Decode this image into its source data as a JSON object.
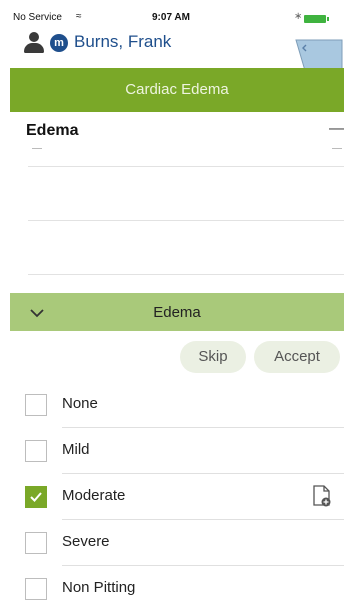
{
  "status_bar": {
    "carrier": "No Service",
    "wifi_icon": "wifi-icon",
    "time": "9:07 AM",
    "bluetooth_icon": "bluetooth-icon",
    "battery_icon": "battery-icon",
    "battery_color": "#3fb33f"
  },
  "patient": {
    "person_icon": "person-icon",
    "badge_letter": "m",
    "name": "Burns, Frank"
  },
  "title_bar": {
    "title": "Cardiac Edema",
    "color": "#7aa828"
  },
  "section": {
    "title": "Edema",
    "collapse_symbol": "—"
  },
  "accordion": {
    "label": "Edema",
    "chevron_icon": "chevron-down-icon",
    "color": "#a9c97a"
  },
  "actions": {
    "skip_label": "Skip",
    "accept_label": "Accept"
  },
  "options": [
    {
      "label": "None",
      "checked": false
    },
    {
      "label": "Mild",
      "checked": false
    },
    {
      "label": "Moderate",
      "checked": true,
      "note_icon": "add-note-icon"
    },
    {
      "label": "Severe",
      "checked": false
    },
    {
      "label": "Non Pitting",
      "checked": false
    }
  ]
}
